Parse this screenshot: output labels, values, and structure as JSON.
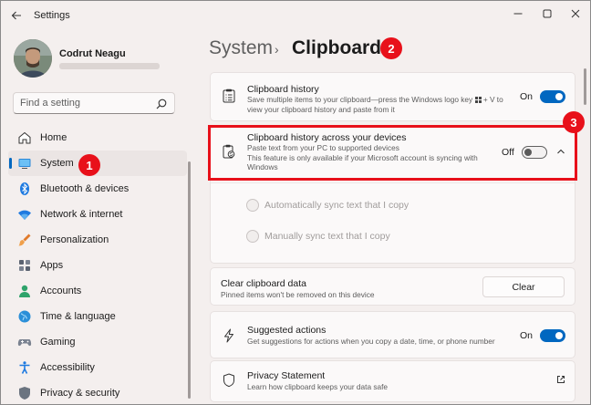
{
  "window": {
    "title": "Settings",
    "controls": [
      "minimize-icon",
      "maximize-icon",
      "close-icon"
    ]
  },
  "user": {
    "name": "Codrut Neagu"
  },
  "search": {
    "placeholder": "Find a setting"
  },
  "sidebar": {
    "items": [
      {
        "label": "Home",
        "icon": "home-icon"
      },
      {
        "label": "System",
        "icon": "system-icon",
        "active": true
      },
      {
        "label": "Bluetooth & devices",
        "icon": "bluetooth-icon"
      },
      {
        "label": "Network & internet",
        "icon": "wifi-icon"
      },
      {
        "label": "Personalization",
        "icon": "brush-icon"
      },
      {
        "label": "Apps",
        "icon": "apps-icon"
      },
      {
        "label": "Accounts",
        "icon": "accounts-icon"
      },
      {
        "label": "Time & language",
        "icon": "globe-icon"
      },
      {
        "label": "Gaming",
        "icon": "gaming-icon"
      },
      {
        "label": "Accessibility",
        "icon": "accessibility-icon"
      },
      {
        "label": "Privacy & security",
        "icon": "shield-icon"
      }
    ]
  },
  "header": {
    "breadcrumb_parent": "System",
    "separator": "›",
    "title": "Clipboard"
  },
  "cards": {
    "history": {
      "title": "Clipboard history",
      "desc_line1": "Save multiple items to your clipboard—press the Windows logo key",
      "desc_key": "+ V to",
      "desc_line2": "view your clipboard history and paste from it",
      "state_label": "On",
      "state": true
    },
    "sync": {
      "title": "Clipboard history across your devices",
      "desc_line1": "Paste text from your PC to supported devices",
      "desc_line2": "This feature is only available if your Microsoft account is syncing with",
      "desc_line3": "Windows",
      "state_label": "Off",
      "state": false,
      "expanded": true,
      "options": [
        {
          "label": "Automatically sync text that I copy",
          "enabled": false
        },
        {
          "label": "Manually sync text that I copy",
          "enabled": false
        }
      ]
    },
    "clear": {
      "title": "Clear clipboard data",
      "desc": "Pinned items won't be removed on this device",
      "button": "Clear"
    },
    "suggested": {
      "title": "Suggested actions",
      "desc": "Get suggestions for actions when you copy a date, time, or phone number",
      "state_label": "On",
      "state": true
    },
    "privacy": {
      "title": "Privacy Statement",
      "desc": "Learn how clipboard keeps your data safe"
    }
  },
  "annotations": {
    "marker_1": "1",
    "marker_2": "2",
    "marker_3": "3"
  },
  "colors": {
    "accent": "#0067c0",
    "annotation_red": "#e8101a"
  }
}
